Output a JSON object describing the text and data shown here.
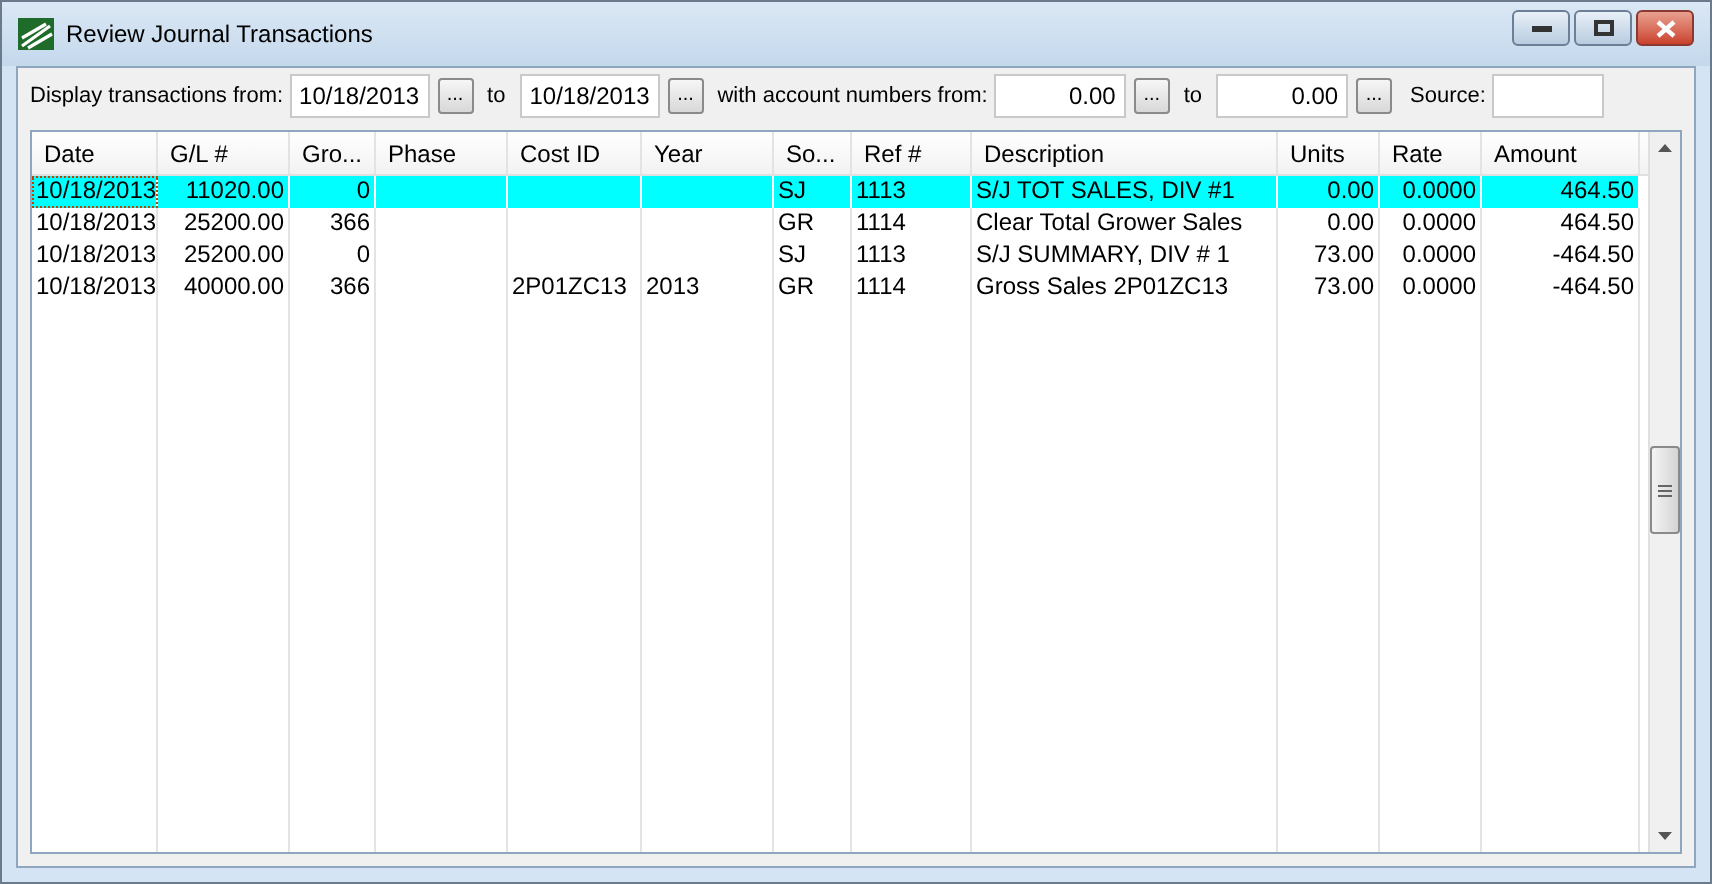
{
  "window": {
    "title": "Review Journal Transactions"
  },
  "filter": {
    "from_label": "Display transactions from:",
    "from_date": "10/18/2013",
    "to_label": "to",
    "to_date": "10/18/2013",
    "accounts_label": "with account numbers from:",
    "from_account": "0.00",
    "to_label_2": "to",
    "to_account": "0.00",
    "source_label": "Source:",
    "browse": "..."
  },
  "table": {
    "columns": [
      {
        "label": "Date"
      },
      {
        "label": "G/L #"
      },
      {
        "label": "Gro..."
      },
      {
        "label": "Phase"
      },
      {
        "label": "Cost ID"
      },
      {
        "label": "Year"
      },
      {
        "label": "So..."
      },
      {
        "label": "Ref #"
      },
      {
        "label": "Description"
      },
      {
        "label": "Units"
      },
      {
        "label": "Rate"
      },
      {
        "label": "Amount"
      }
    ],
    "rows": [
      {
        "selected": true,
        "cells": [
          "10/18/2013",
          "11020.00",
          "0",
          "",
          "",
          "",
          "SJ",
          "1113",
          "S/J TOT SALES, DIV #1",
          "0.00",
          "0.0000",
          "464.50"
        ]
      },
      {
        "selected": false,
        "cells": [
          "10/18/2013",
          "25200.00",
          "366",
          "",
          "",
          "",
          "GR",
          "1114",
          "Clear Total Grower Sales",
          "0.00",
          "0.0000",
          "464.50"
        ]
      },
      {
        "selected": false,
        "cells": [
          "10/18/2013",
          "25200.00",
          "0",
          "",
          "",
          "",
          "SJ",
          "1113",
          "S/J SUMMARY, DIV # 1",
          "73.00",
          "0.0000",
          "-464.50"
        ]
      },
      {
        "selected": false,
        "cells": [
          "10/18/2013",
          "40000.00",
          "366",
          "",
          "2P01ZC13",
          "2013",
          "GR",
          "1114",
          "Gross Sales 2P01ZC13",
          "73.00",
          "0.0000",
          "-464.50"
        ]
      }
    ]
  }
}
